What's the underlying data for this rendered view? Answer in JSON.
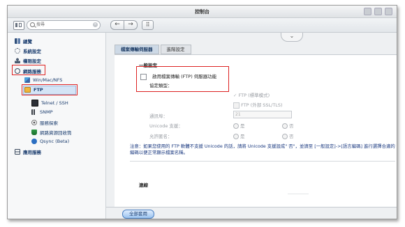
{
  "window": {
    "title": "控制台"
  },
  "toolbar": {
    "search_placeholder": "搜尋"
  },
  "sidebar": {
    "items": [
      {
        "label": "總覽"
      },
      {
        "label": "系統設定"
      },
      {
        "label": "權限設定"
      },
      {
        "label": "網路服務"
      },
      {
        "label": "Win/Mac/NFS"
      },
      {
        "label": "FTP"
      },
      {
        "label": "Telnet / SSH"
      },
      {
        "label": "SNMP"
      },
      {
        "label": "服務探索"
      },
      {
        "label": "網路資源回收筒"
      },
      {
        "label": "Qsync (Beta)"
      },
      {
        "label": "應用服務"
      }
    ]
  },
  "tabs": [
    {
      "label": "檔案傳輸伺服器"
    },
    {
      "label": "進階設定"
    }
  ],
  "general": {
    "title": "一般設定",
    "enable_ftp": "啟用檔案傳輸 (FTP) 伺服器功能",
    "protocol_type": "協定類型：",
    "ftp_standard": "FTP (標準模式)",
    "ftp_ssl": "FTP (外部 SSL/TLS)",
    "port_label": "通訊埠：",
    "port_value": "21",
    "unicode_label": "Unicode 支援：",
    "anonymous_label": "允許匿名：",
    "yes": "是",
    "no": "否"
  },
  "note": "注意：如果您使用的 FTP 軟體不支援 Unicode 的話，請將 Unicode 支援設成\" 否\"，並請至 [一般設定]->[語言編碼] 進行選擇合適的編碼以便正常顯示檔案名稱。",
  "connection": {
    "title": "連線"
  },
  "footer": {
    "apply_all": "全部套用"
  },
  "colors": {
    "accent": "#1a3c6e",
    "highlight": "#d22222",
    "note": "#1b3a80"
  }
}
